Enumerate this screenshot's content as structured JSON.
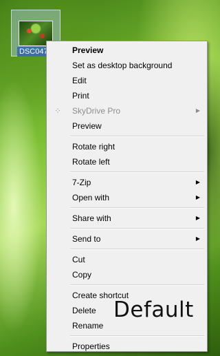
{
  "desktop": {
    "icon_label": "DSC047"
  },
  "menu": {
    "groups": [
      [
        {
          "label": "Preview",
          "bold": true
        },
        {
          "label": "Set as desktop background"
        },
        {
          "label": "Edit"
        },
        {
          "label": "Print"
        },
        {
          "label": "SkyDrive Pro",
          "disabled": true,
          "submenu": true,
          "icon": "skydrive-icon"
        },
        {
          "label": "Preview"
        }
      ],
      [
        {
          "label": "Rotate right"
        },
        {
          "label": "Rotate left"
        }
      ],
      [
        {
          "label": "7-Zip",
          "submenu": true
        },
        {
          "label": "Open with",
          "submenu": true
        }
      ],
      [
        {
          "label": "Share with",
          "submenu": true
        }
      ],
      [
        {
          "label": "Send to",
          "submenu": true
        }
      ],
      [
        {
          "label": "Cut"
        },
        {
          "label": "Copy"
        }
      ],
      [
        {
          "label": "Create shortcut"
        },
        {
          "label": "Delete"
        },
        {
          "label": "Rename"
        }
      ],
      [
        {
          "label": "Properties"
        }
      ]
    ]
  },
  "overlay": {
    "text": "Default"
  },
  "colors": {
    "menu_bg": "#f0f0f0",
    "selection_blue": "#3f6ea6",
    "disabled_text": "#8d8d8d"
  }
}
